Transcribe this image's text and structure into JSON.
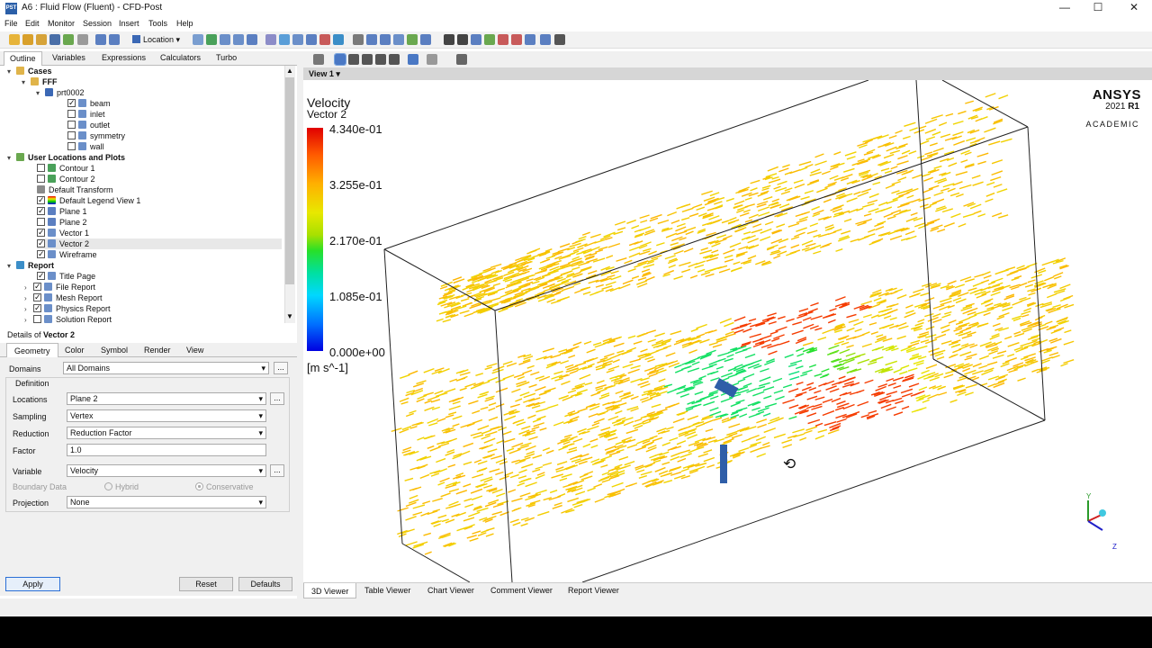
{
  "window": {
    "title": "A6 : Fluid Flow (Fluent) - CFD-Post",
    "icon_text": "PST"
  },
  "menu": [
    "File",
    "Edit",
    "Monitor",
    "Session",
    "Insert",
    "Tools",
    "Help"
  ],
  "toolbar": {
    "location_label": "Location"
  },
  "outline_tabs": [
    "Outline",
    "Variables",
    "Expressions",
    "Calculators",
    "Turbo"
  ],
  "tree": {
    "cases_label": "Cases",
    "fff_label": "FFF",
    "part_label": "prt0002",
    "boundaries": [
      "beam",
      "inlet",
      "outlet",
      "symmetry",
      "wall"
    ],
    "user_locations_label": "User Locations and Plots",
    "user_items": [
      "Contour 1",
      "Contour 2",
      "Default Transform",
      "Default Legend View 1",
      "Plane 1",
      "Plane 2",
      "Vector 1",
      "Vector 2",
      "Wireframe"
    ],
    "report_label": "Report",
    "report_items": [
      "Title Page",
      "File Report",
      "Mesh Report",
      "Physics Report",
      "Solution Report"
    ]
  },
  "details": {
    "prefix": "Details of ",
    "object": "Vector 2",
    "tabs": [
      "Geometry",
      "Color",
      "Symbol",
      "Render",
      "View"
    ],
    "domains_label": "Domains",
    "domains_value": "All Domains",
    "definition_label": "Definition",
    "locations_label": "Locations",
    "locations_value": "Plane 2",
    "sampling_label": "Sampling",
    "sampling_value": "Vertex",
    "reduction_label": "Reduction",
    "reduction_value": "Reduction Factor",
    "factor_label": "Factor",
    "factor_value": "1.0",
    "variable_label": "Variable",
    "variable_value": "Velocity",
    "boundary_label": "Boundary Data",
    "hybrid_label": "Hybrid",
    "conservative_label": "Conservative",
    "projection_label": "Projection",
    "projection_value": "None",
    "ellipsis": "...",
    "apply_label": "Apply",
    "reset_label": "Reset",
    "defaults_label": "Defaults"
  },
  "viewer": {
    "view_label": "View 1",
    "legend_title": "Velocity",
    "legend_sub": "Vector 2",
    "legend_values": [
      "4.340e-01",
      "3.255e-01",
      "2.170e-01",
      "1.085e-01",
      "0.000e+00"
    ],
    "legend_units": "[m s^-1]",
    "logo": "ANSYS",
    "version_year": "2021",
    "version_release": "R1",
    "edition": "ACADEMIC",
    "axis_y": "Y",
    "axis_z": "Z",
    "tabs": [
      "3D Viewer",
      "Table Viewer",
      "Chart Viewer",
      "Comment Viewer",
      "Report Viewer"
    ]
  },
  "colors": {
    "accent": "#2b6fd6",
    "legend_max": "#e00000",
    "legend_min": "#0000e0"
  }
}
